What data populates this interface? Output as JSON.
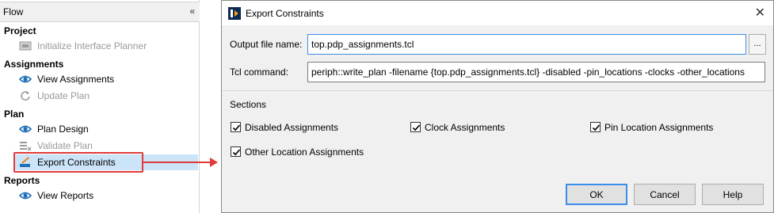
{
  "flow": {
    "title": "Flow",
    "collapse_glyph": "«",
    "sections": [
      {
        "label": "Project"
      },
      {
        "label": "Assignments"
      },
      {
        "label": "Plan"
      },
      {
        "label": "Reports"
      }
    ],
    "items": [
      {
        "label": "Initialize Interface Planner",
        "icon": "interface-planner-icon",
        "enabled": false
      },
      {
        "label": "View Assignments",
        "icon": "eye-icon",
        "enabled": true
      },
      {
        "label": "Update Plan",
        "icon": "refresh-icon",
        "enabled": false
      },
      {
        "label": "Plan Design",
        "icon": "eye-icon",
        "enabled": true
      },
      {
        "label": "Validate Plan",
        "icon": "validate-icon",
        "enabled": false
      },
      {
        "label": "Export Constraints",
        "icon": "export-icon",
        "enabled": true,
        "selected": true
      },
      {
        "label": "View Reports",
        "icon": "eye-icon",
        "enabled": true
      }
    ]
  },
  "dialog": {
    "title": "Export Constraints",
    "close_glyph": "✕",
    "output_file_label": "Output file name:",
    "output_file_value": "top.pdp_assignments.tcl",
    "browse_label": "...",
    "tcl_command_label": "Tcl command:",
    "tcl_command_value": "periph::write_plan -filename {top.pdp_assignments.tcl} -disabled -pin_locations -clocks -other_locations",
    "sections_label": "Sections",
    "checkboxes": [
      {
        "label": "Disabled Assignments",
        "checked": true
      },
      {
        "label": "Clock Assignments",
        "checked": true
      },
      {
        "label": "Pin Location Assignments",
        "checked": true
      },
      {
        "label": "Other Location Assignments",
        "checked": true
      }
    ],
    "buttons": {
      "ok": "OK",
      "cancel": "Cancel",
      "help": "Help"
    }
  },
  "colors": {
    "highlight": "#e03a3a",
    "selection": "#cce4f7",
    "focus_border": "#3c8ee8",
    "eye_icon": "#1f6fb8"
  }
}
